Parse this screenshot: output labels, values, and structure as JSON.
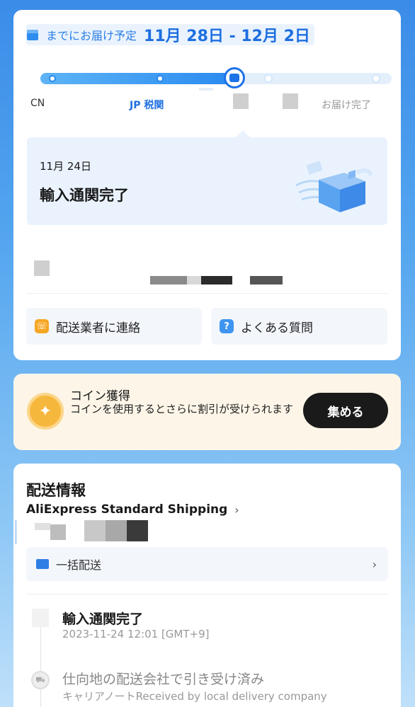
{
  "delivery": {
    "prefix": "までにお届け予定",
    "dates": "11月 28日 - 12月 2日",
    "progress_fraction": 0.55
  },
  "stages": {
    "cn": "CN",
    "jp": "JP 税関",
    "done": "お届け完了"
  },
  "status": {
    "date": "11月 24日",
    "title": "輸入通関完了"
  },
  "actions": {
    "contact": "配送業者に連絡",
    "faq": "よくある質問"
  },
  "coins": {
    "title": "コイン獲得",
    "desc": "コインを使用するとさらに割引が受けられます",
    "button": "集める"
  },
  "shipping": {
    "title": "配送情報",
    "carrier": "AliExpress Standard Shipping",
    "combined": "一括配送",
    "events": [
      {
        "title": "輸入通関完了",
        "time": "2023-11-24 12:01 [GMT+9]"
      },
      {
        "title": "仕向地の配送会社で引き受け済み",
        "desc": "キャリアノートReceived by local  delivery company"
      }
    ]
  },
  "colors": {
    "accent": "#1e6fe0",
    "button_dark": "#1a1a1a",
    "coin": "#f6b73d"
  }
}
